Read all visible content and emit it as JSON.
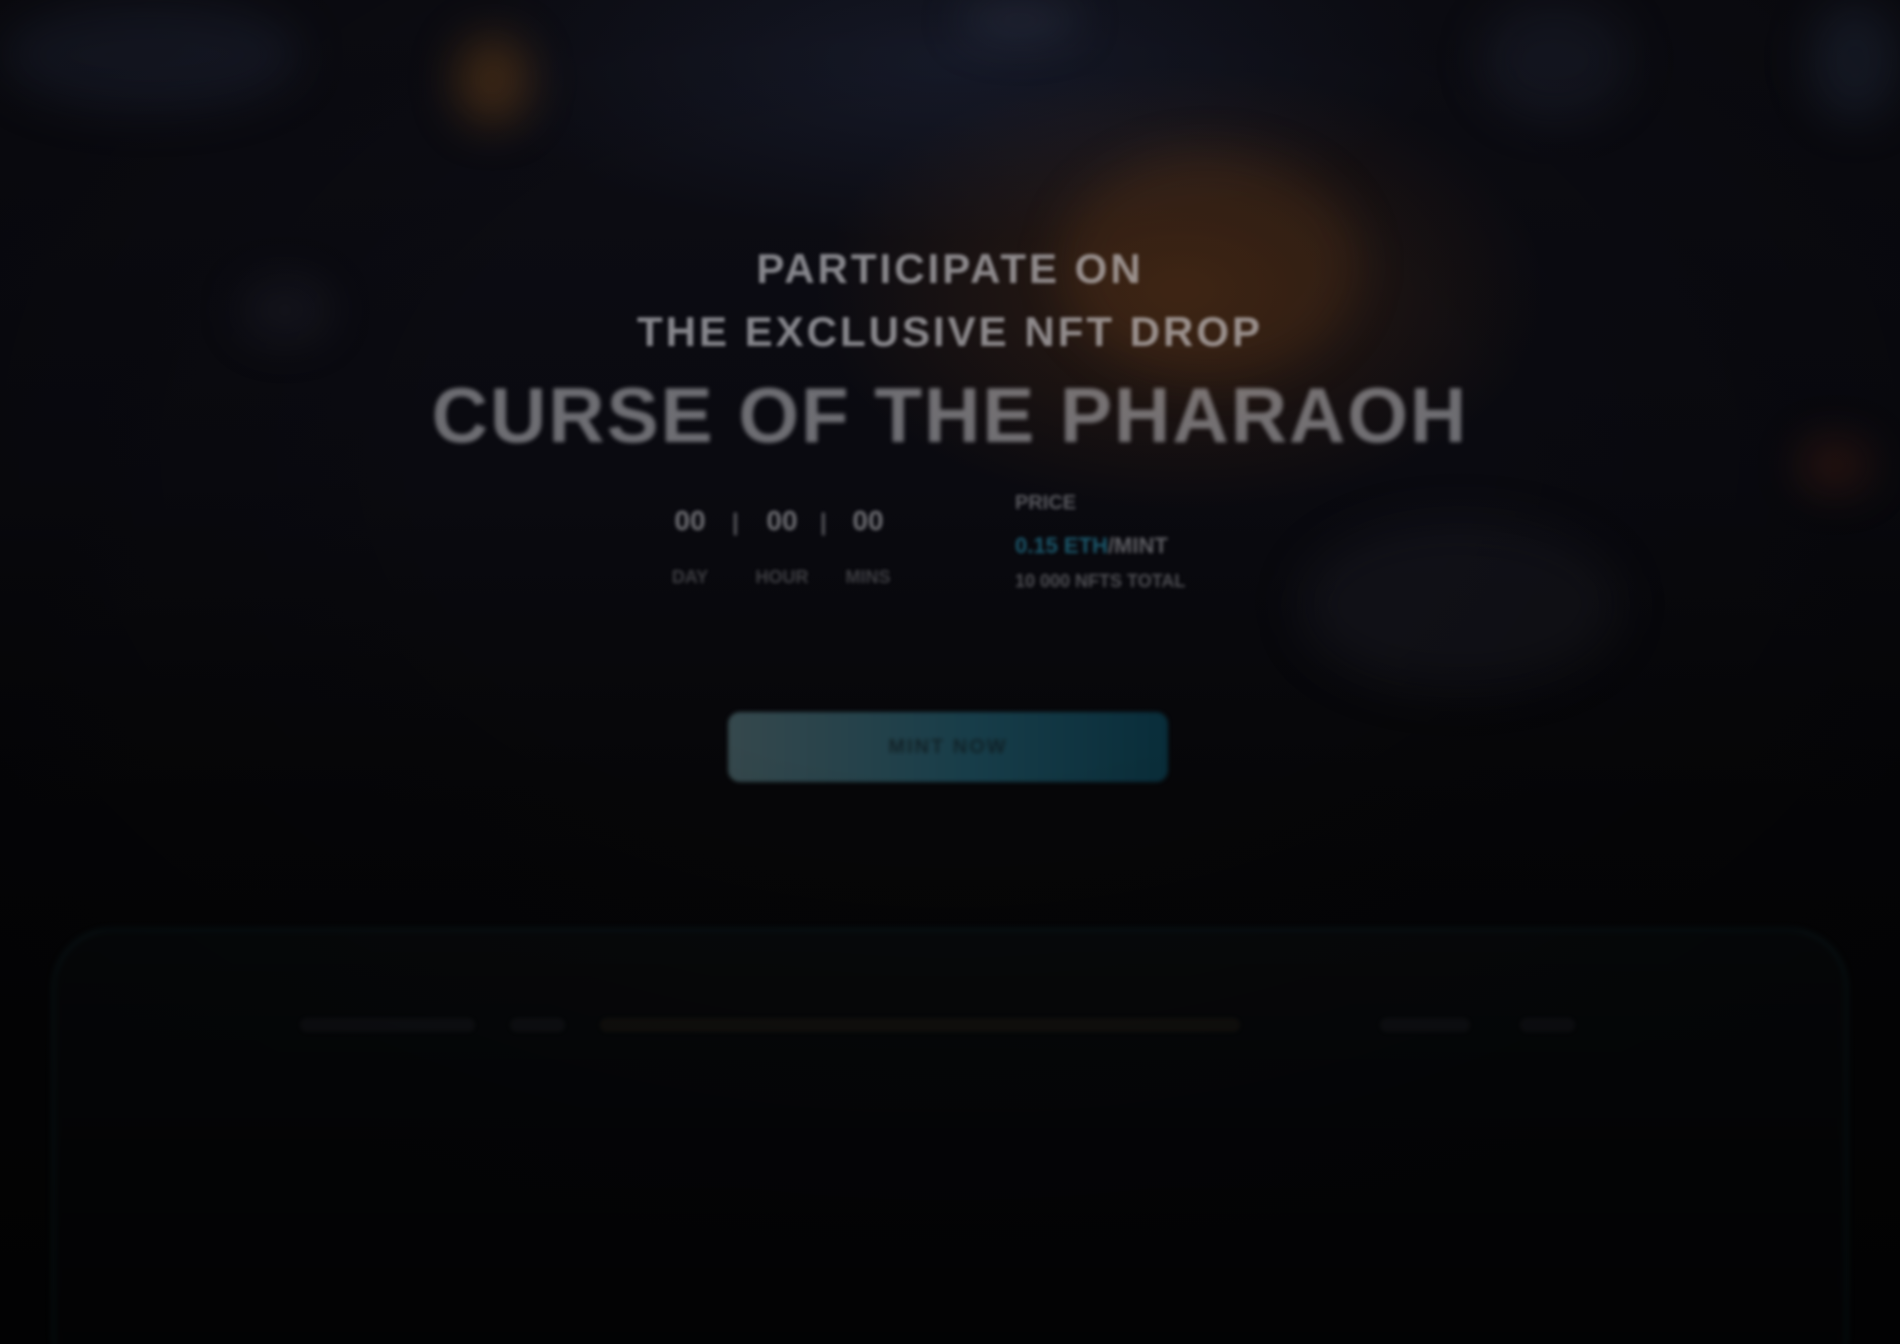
{
  "hero": {
    "eyebrow_line1": "PARTICIPATE ON",
    "eyebrow_line2": "THE EXCLUSIVE NFT DROP",
    "title": "CURSE OF THE PHARAOH"
  },
  "countdown": {
    "days": "00",
    "hours": "00",
    "minutes": "00",
    "days_label": "DAY",
    "hours_label": "HOUR",
    "minutes_label": "MINS"
  },
  "mint": {
    "label": "PRICE",
    "price_accent": "0.15 ETH",
    "price_rest": "/MINT",
    "supply": "10 000 NFTS TOTAL",
    "accent_color": "#2a8ca8"
  },
  "cta": {
    "label": "MINT NOW"
  },
  "panel_nav": {
    "item1": "",
    "item2": "",
    "item3": "",
    "item4": "",
    "item5": ""
  }
}
